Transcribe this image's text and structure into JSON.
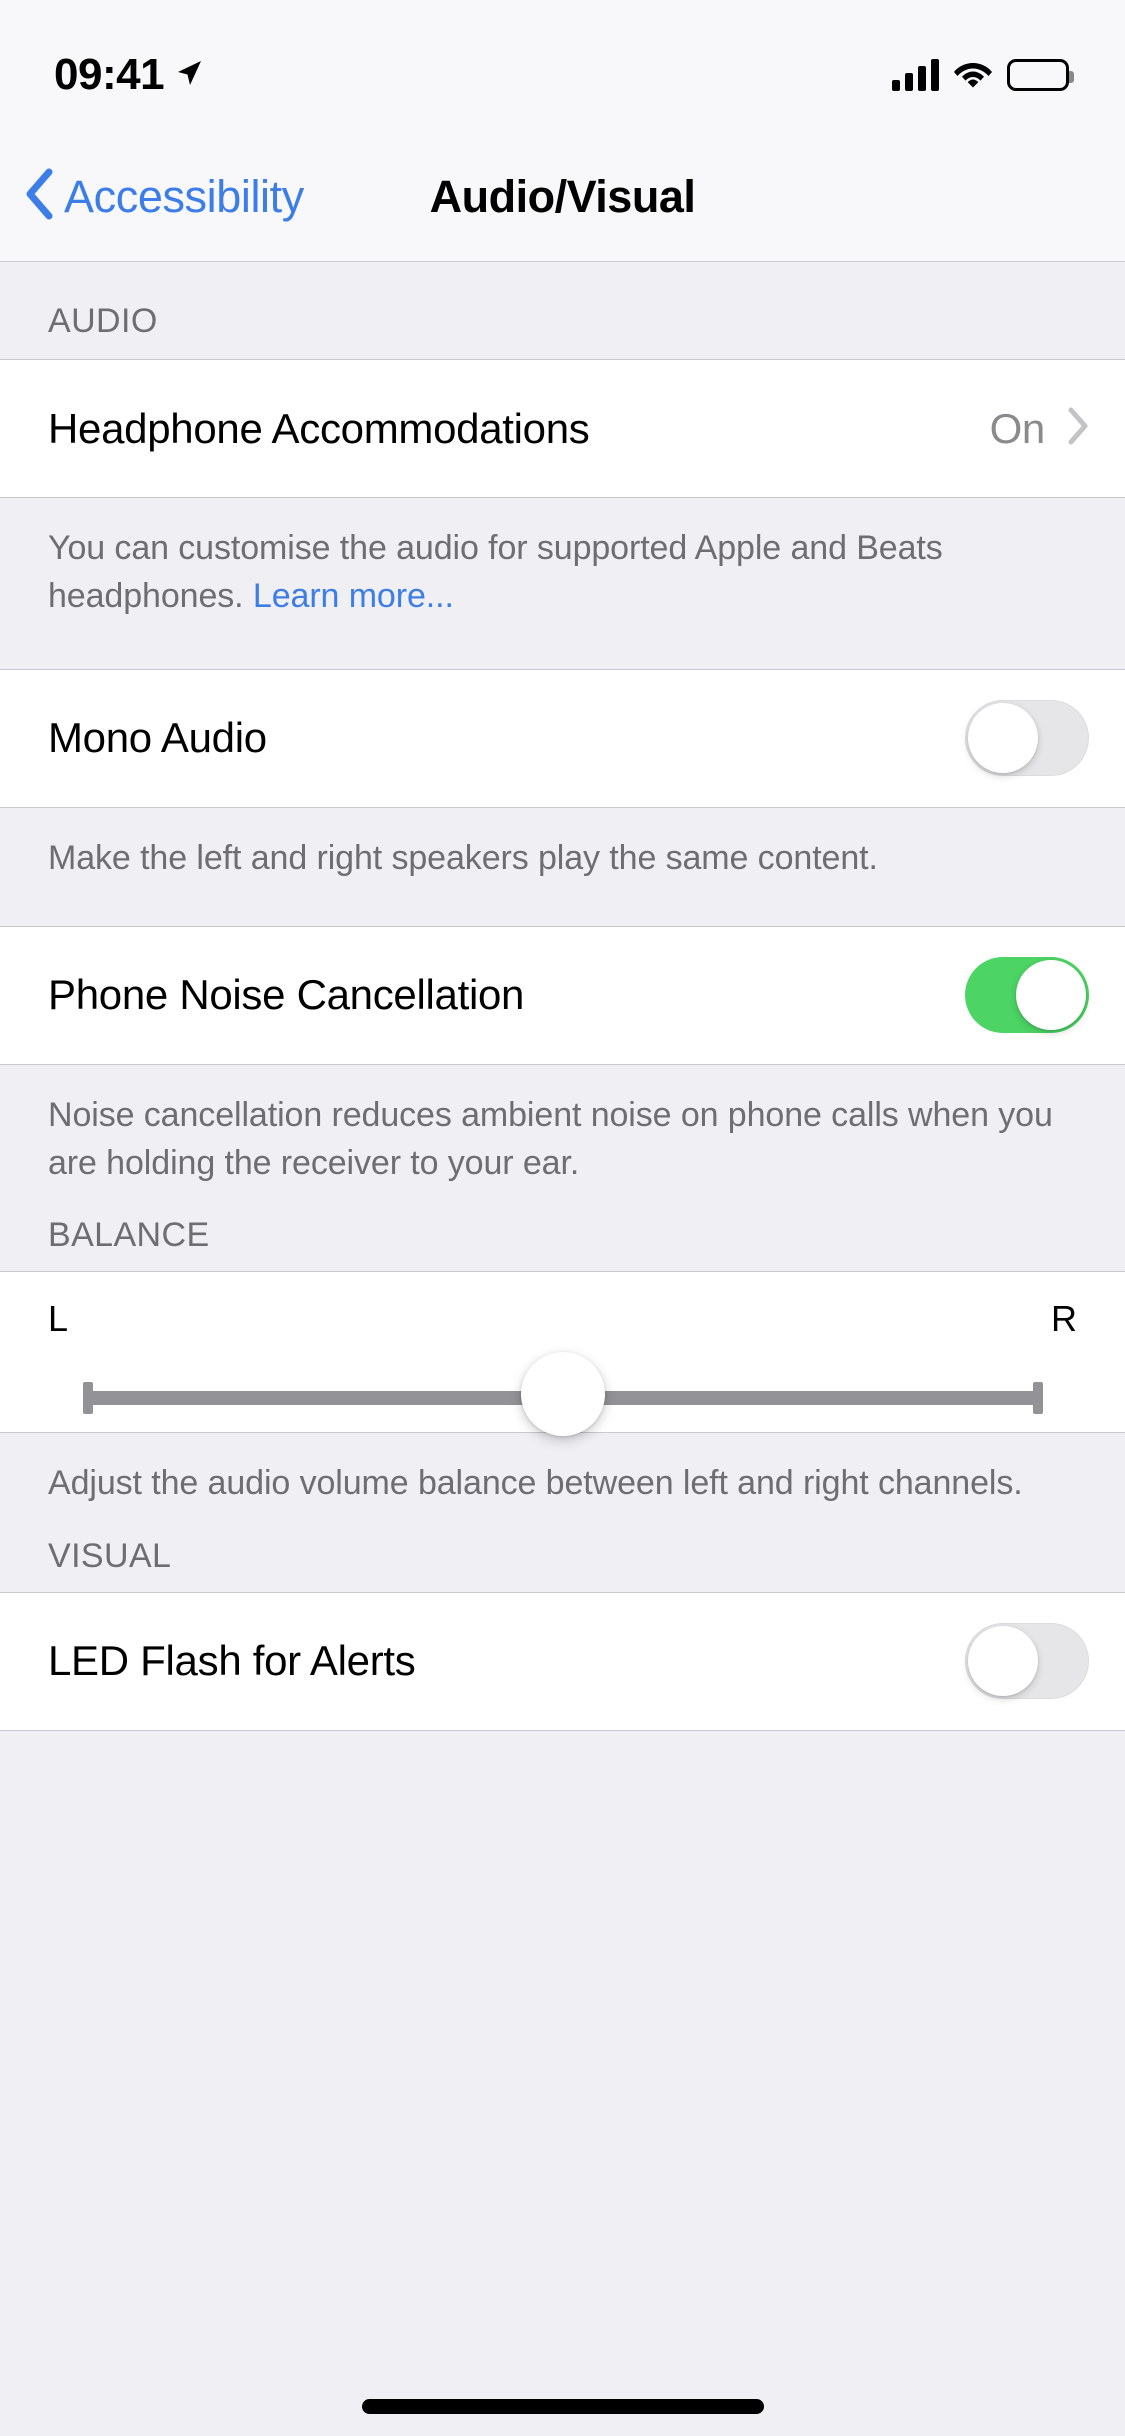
{
  "status_bar": {
    "time": "09:41",
    "location_icon": "location-arrow-icon",
    "signal_icon": "cellular-bars-icon",
    "wifi_icon": "wifi-icon",
    "battery_icon": "battery-full-icon"
  },
  "nav": {
    "back_label": "Accessibility",
    "back_icon": "chevron-left-icon",
    "title": "Audio/Visual"
  },
  "sections": {
    "audio": {
      "header": "AUDIO",
      "headphone_accommodations": {
        "label": "Headphone Accommodations",
        "value": "On",
        "disclosure_icon": "chevron-right-icon"
      },
      "headphone_footnote": {
        "text": "You can customise the audio for supported Apple and Beats ",
        "text2": "headphones. ",
        "link": "Learn more..."
      },
      "mono_audio": {
        "label": "Mono Audio",
        "state": "off"
      },
      "mono_audio_footnote": "Make the left and right speakers play the same content.",
      "phone_noise_cancellation": {
        "label": "Phone Noise Cancellation",
        "state": "on"
      },
      "phone_noise_footnote": "Noise cancellation reduces ambient noise on phone calls when you are holding the receiver to your ear."
    },
    "balance": {
      "header": "BALANCE",
      "left_label": "L",
      "right_label": "R",
      "value": 0.5,
      "footnote": "Adjust the audio volume balance between left and right channels."
    },
    "visual": {
      "header": "VISUAL",
      "led_flash": {
        "label": "LED Flash for Alerts",
        "state": "off"
      }
    }
  },
  "colors": {
    "accent_blue": "#3C7DE8",
    "toggle_on_green": "#4CD464",
    "group_background": "#FFFFFF",
    "page_background": "#EFEFF4",
    "secondary_text": "#6D6D72"
  }
}
